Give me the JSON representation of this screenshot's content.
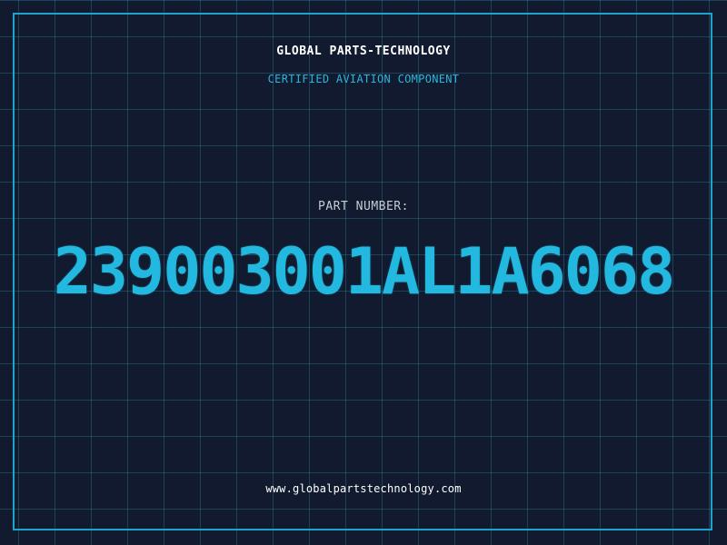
{
  "header": {
    "company": "GLOBAL PARTS-TECHNOLOGY",
    "subtitle": "CERTIFIED AVIATION COMPONENT"
  },
  "part": {
    "label": "PART NUMBER:",
    "number": "239003001AL1A6068"
  },
  "footer": {
    "website": "www.globalpartstechnology.com"
  },
  "colors": {
    "background": "#111a2e",
    "grid": "#28788c",
    "accent": "#22b8df",
    "text": "#ffffff"
  }
}
